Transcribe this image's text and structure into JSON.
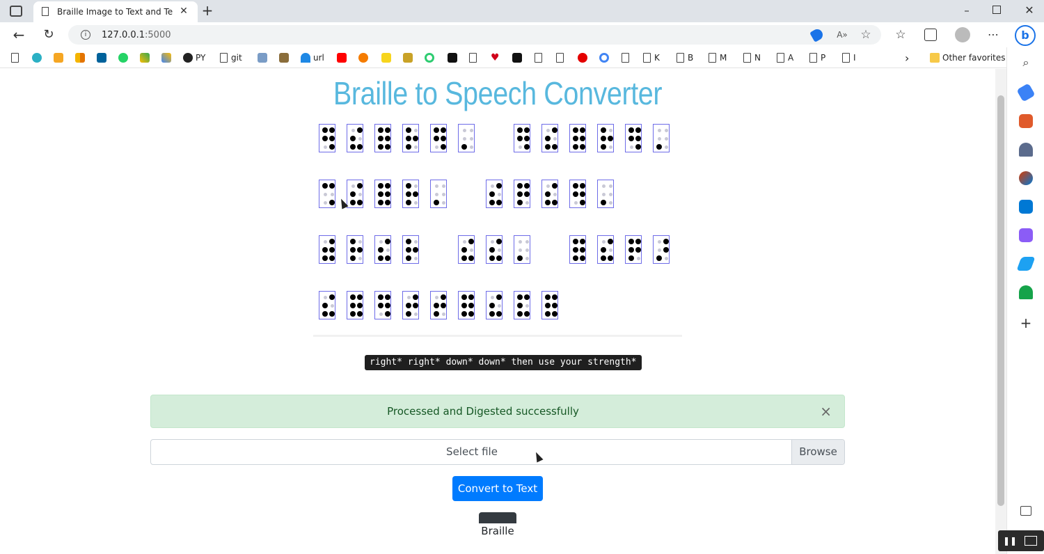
{
  "browser": {
    "tab_title": "Braille Image to Text and Text to",
    "url_host": "127.0.0.1",
    "url_port": ":5000",
    "bookmarks": [
      "PY",
      "git",
      "url",
      "K",
      "B",
      "M",
      "N",
      "A",
      "P",
      "I"
    ],
    "other_favorites": "Other favorites"
  },
  "page": {
    "title": "Braille to Speech Converter",
    "hint_code": "right* right* down* down* then use your strength*",
    "alert_message": "Processed and Digested successfully",
    "alert_close": "×",
    "file_placeholder": "Select file",
    "browse_label": "Browse",
    "convert_label": "Convert to Text",
    "tooltip_text": "Braille"
  },
  "colors": {
    "title": "#58b8de",
    "primary": "#007bff",
    "alert_bg": "#d4edda",
    "cell_border": "#6d6be8"
  },
  "braille_rows": [
    [
      "110111",
      "011101",
      "111111",
      "111010",
      "110111",
      "001000",
      "",
      "110111",
      "011101",
      "111111",
      "111010",
      "110111",
      "001000"
    ],
    [
      "100101",
      "011101",
      "111111",
      "111010",
      "001000",
      "",
      "011101",
      "111110",
      "011101",
      "110111",
      "001000"
    ],
    [
      "011111",
      "111010",
      "011101",
      "111010",
      "",
      "011101",
      "011101",
      "001000",
      "",
      "111111",
      "011101",
      "111110",
      "001110"
    ],
    [
      "011101",
      "111111",
      "110111",
      "011110",
      "011110",
      "111111",
      "011101",
      "111101",
      "111111"
    ]
  ]
}
